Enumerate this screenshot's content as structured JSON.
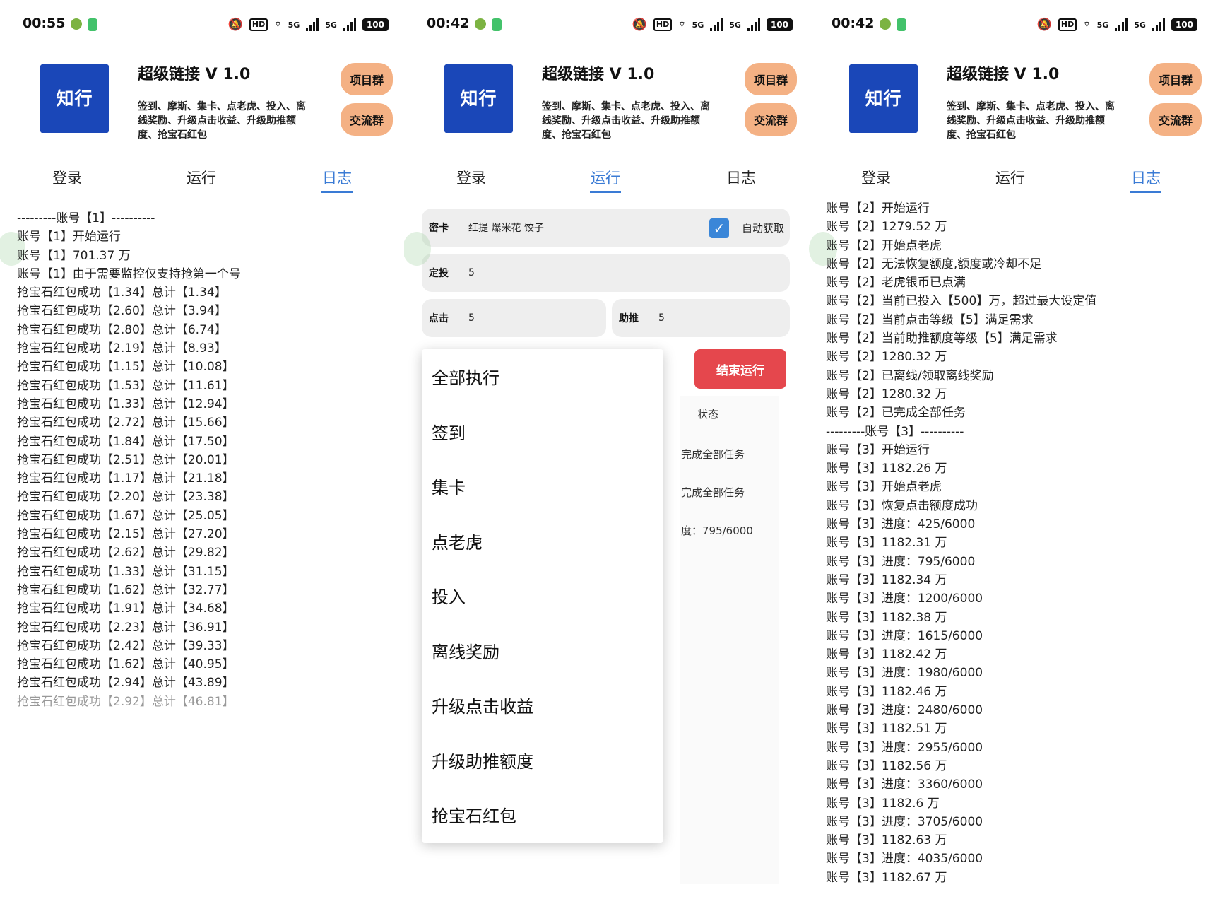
{
  "app": {
    "title": "超级链接 V 1.0",
    "description": "签到、摩斯、集卡、点老虎、投入、离线奖励、升级点击收益、升级助推额度、抢宝石红包",
    "logo_text": "知行",
    "project_group_button": "项目群",
    "chat_group_button": "交流群"
  },
  "tabs": [
    "登录",
    "运行",
    "日志"
  ],
  "panels": [
    {
      "time": "00:55",
      "active_tab": 2,
      "log": [
        "---------账号【1】----------",
        "账号【1】开始运行",
        "账号【1】701.37 万",
        "账号【1】由于需要监控仅支持抢第一个号",
        "抢宝石红包成功【1.34】总计【1.34】",
        "抢宝石红包成功【2.60】总计【3.94】",
        "抢宝石红包成功【2.80】总计【6.74】",
        "抢宝石红包成功【2.19】总计【8.93】",
        "抢宝石红包成功【1.15】总计【10.08】",
        "抢宝石红包成功【1.53】总计【11.61】",
        "抢宝石红包成功【1.33】总计【12.94】",
        "抢宝石红包成功【2.72】总计【15.66】",
        "抢宝石红包成功【1.84】总计【17.50】",
        "抢宝石红包成功【2.51】总计【20.01】",
        "抢宝石红包成功【1.17】总计【21.18】",
        "抢宝石红包成功【2.20】总计【23.38】",
        "抢宝石红包成功【1.67】总计【25.05】",
        "抢宝石红包成功【2.15】总计【27.20】",
        "抢宝石红包成功【2.62】总计【29.82】",
        "抢宝石红包成功【1.33】总计【31.15】",
        "抢宝石红包成功【1.62】总计【32.77】",
        "抢宝石红包成功【1.91】总计【34.68】",
        "抢宝石红包成功【2.23】总计【36.91】",
        "抢宝石红包成功【2.42】总计【39.33】",
        "抢宝石红包成功【1.62】总计【40.95】",
        "抢宝石红包成功【2.94】总计【43.89】",
        "抢宝石红包成功【2.92】总计【46.81】"
      ]
    },
    {
      "time": "00:42",
      "active_tab": 1,
      "run": {
        "card_label": "密卡",
        "card_value": "红提 爆米花 饺子",
        "auto_fetch_label": "自动获取",
        "auto_fetch_checked": true,
        "fixed_bet_label": "定投",
        "fixed_bet_value": "5",
        "click_label": "点击",
        "click_value": "5",
        "boost_label": "助推",
        "boost_value": "5",
        "stop_button": "结束运行",
        "status_header": "状态",
        "status_rows": [
          "完成全部任务",
          "完成全部任务",
          "度：795/6000"
        ],
        "menu": [
          "全部执行",
          "签到",
          "集卡",
          "点老虎",
          "投入",
          "离线奖励",
          "升级点击收益",
          "升级助推额度",
          "抢宝石红包"
        ]
      }
    },
    {
      "time": "00:42",
      "active_tab": 2,
      "log": [
        "账号【2】开始运行",
        "账号【2】1279.52 万",
        "账号【2】开始点老虎",
        "账号【2】无法恢复额度,额度或冷却不足",
        "账号【2】老虎银币已点满",
        "账号【2】当前已投入【500】万，超过最大设定值",
        "账号【2】当前点击等级【5】满足需求",
        "账号【2】当前助推额度等级【5】满足需求",
        "账号【2】1280.32 万",
        "账号【2】已离线/领取离线奖励",
        "账号【2】1280.32 万",
        "账号【2】已完成全部任务",
        "---------账号【3】----------",
        "账号【3】开始运行",
        "账号【3】1182.26 万",
        "账号【3】开始点老虎",
        "账号【3】恢复点击额度成功",
        "账号【3】进度：425/6000",
        "账号【3】1182.31 万",
        "账号【3】进度：795/6000",
        "账号【3】1182.34 万",
        "账号【3】进度：1200/6000",
        "账号【3】1182.38 万",
        "账号【3】进度：1615/6000",
        "账号【3】1182.42 万",
        "账号【3】进度：1980/6000",
        "账号【3】1182.46 万",
        "账号【3】进度：2480/6000",
        "账号【3】1182.51 万",
        "账号【3】进度：2955/6000",
        "账号【3】1182.56 万",
        "账号【3】进度：3360/6000",
        "账号【3】1182.6 万",
        "账号【3】进度：3705/6000",
        "账号【3】1182.63 万",
        "账号【3】进度：4035/6000",
        "账号【3】1182.67 万"
      ]
    }
  ],
  "status": {
    "hd": "HD",
    "network": "5G",
    "battery": "100"
  },
  "colors": {
    "accent": "#3a7bd5",
    "logo_bg": "#1a47b8",
    "pill_bg": "#f4b184",
    "stop_red": "#e5474d"
  }
}
